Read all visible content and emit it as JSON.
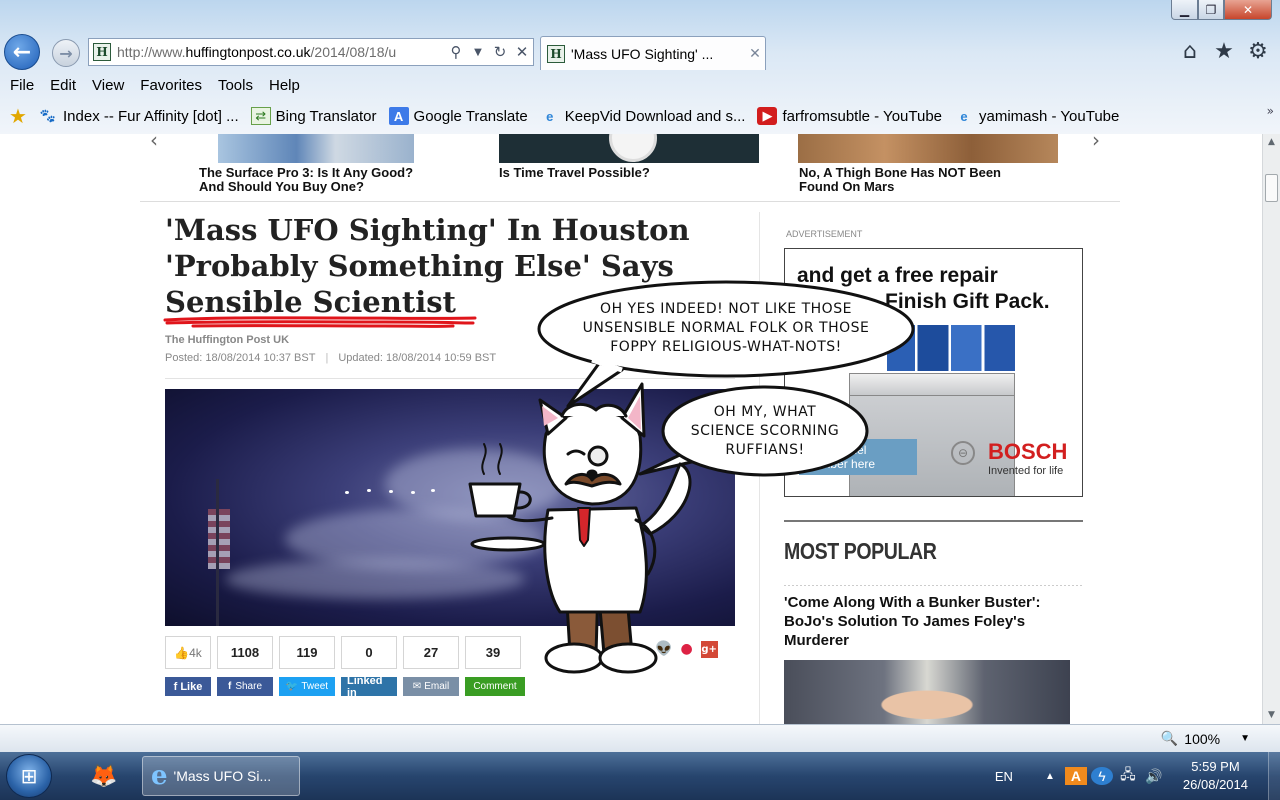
{
  "browser": {
    "address": {
      "prefix": "http://www.",
      "domain": "huffingtonpost.co.uk",
      "path": "/2014/08/18/u"
    },
    "tab_title": "'Mass UFO Sighting' ...",
    "menu": [
      "File",
      "Edit",
      "View",
      "Favorites",
      "Tools",
      "Help"
    ],
    "favorites": [
      {
        "label": "Index -- Fur Affinity [dot] ...",
        "icon": "paw-icon"
      },
      {
        "label": "Bing Translator",
        "icon": "bing-icon"
      },
      {
        "label": "Google Translate",
        "icon": "google-translate-icon"
      },
      {
        "label": "KeepVid Download and s...",
        "icon": "ie-page-icon"
      },
      {
        "label": "farfromsubtle - YouTube",
        "icon": "youtube-icon"
      },
      {
        "label": "yamimash - YouTube",
        "icon": "ie-page-icon"
      }
    ],
    "zoom": "100%"
  },
  "page": {
    "related": [
      {
        "caption": "The Surface Pro 3: Is It Any Good? And Should You Buy One?"
      },
      {
        "caption": "Is Time Travel Possible?"
      },
      {
        "caption": "No, A Thigh Bone Has NOT Been Found On Mars"
      }
    ],
    "article": {
      "headline_l1": "'Mass UFO Sighting' In Houston",
      "headline_l2": "'Probably Something Else' Says",
      "headline_l3": "Sensible Scientist",
      "byline": "The Huffington Post UK",
      "posted": "Posted: 18/08/2014 10:37 BST",
      "updated": "Updated: 18/08/2014 10:59 BST"
    },
    "share": {
      "likes": "4k",
      "counts": [
        "1108",
        "119",
        "0",
        "27",
        "39"
      ],
      "buttons": {
        "like": "Like",
        "share": "Share",
        "tweet": "Tweet",
        "linkedin": "Linked in",
        "email": "Email",
        "comment": "Comment"
      }
    },
    "sidebar": {
      "ad_label": "ADVERTISEMENT",
      "ad": {
        "headline_l1": "and get a free repair",
        "headline_l2": "Finish Gift Pack.",
        "cta": "your model number here",
        "brand": "BOSCH",
        "tagline": "Invented for life"
      },
      "most_popular_title": "MOST POPULAR",
      "most_popular_first": "'Come Along With a Bunker Buster': BoJo's Solution To James Foley's Murderer"
    },
    "comic": {
      "bubble1_l1": "OH YES INDEED! NOT LIKE THOSE",
      "bubble1_l2": "UNSENSIBLE NORMAL FOLK OR THOSE",
      "bubble1_l3": "FOPPY RELIGIOUS-WHAT-NOTS!",
      "bubble2_l1": "OH MY, WHAT",
      "bubble2_l2": "SCIENCE SCORNING",
      "bubble2_l3": "RUFFIANS!"
    }
  },
  "taskbar": {
    "ie_label": "'Mass UFO Si...",
    "lang": "EN",
    "time": "5:59 PM",
    "date": "26/08/2014"
  },
  "colors": {
    "huffpost_green": "#1c4a2b",
    "scribble_red": "#e0151b",
    "bosch_red": "#d21f1f"
  }
}
